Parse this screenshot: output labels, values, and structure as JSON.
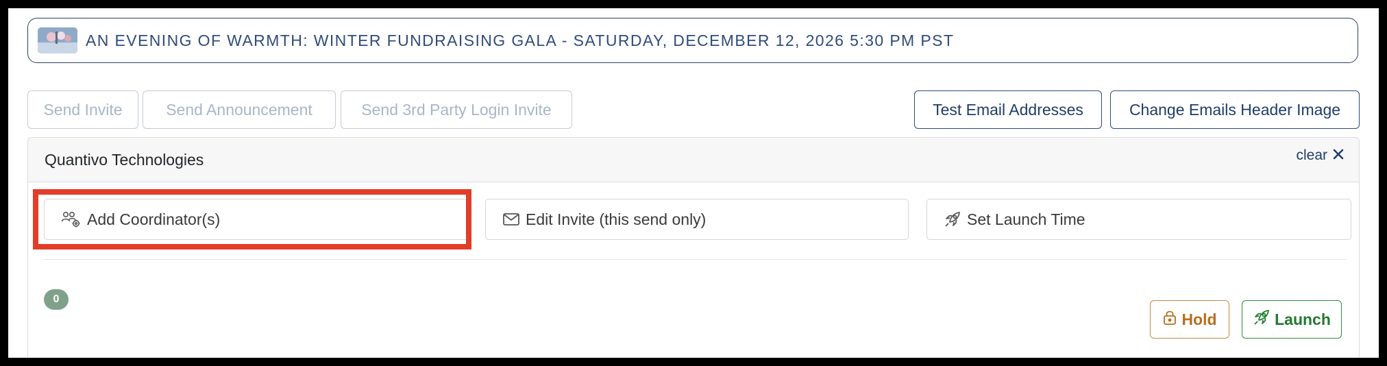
{
  "event": {
    "title": "AN EVENING OF WARMTH: WINTER FUNDRAISING GALA - SATURDAY, DECEMBER 12, 2026 5:30 PM PST",
    "thumbnail_icon": "event-photo-thumbnail"
  },
  "toolbar": {
    "send_invite": "Send Invite",
    "send_announcement": "Send Announcement",
    "send_third_party": "Send 3rd Party Login Invite",
    "test_emails": "Test Email Addresses",
    "change_header": "Change Emails Header Image"
  },
  "panel": {
    "title": "Quantivo Technologies",
    "clear_label": "clear",
    "actions": {
      "add_coordinator": "Add Coordinator(s)",
      "edit_invite": "Edit Invite (this send only)",
      "set_launch_time": "Set Launch Time"
    },
    "count": "0",
    "hold_label": "Hold",
    "launch_label": "Launch"
  },
  "colors": {
    "primary": "#1f3d66",
    "disabled": "#a9b6c7",
    "hold": "#b86e1b",
    "launch": "#217a2e",
    "badge": "#7fa18a",
    "highlight": "#e23d28"
  },
  "icons": {
    "add_coordinator": "users-gear-icon",
    "edit_invite": "envelope-icon",
    "set_launch_time": "rocket-icon",
    "clear": "close-icon",
    "hold": "lock-icon",
    "launch": "rocket-icon"
  }
}
